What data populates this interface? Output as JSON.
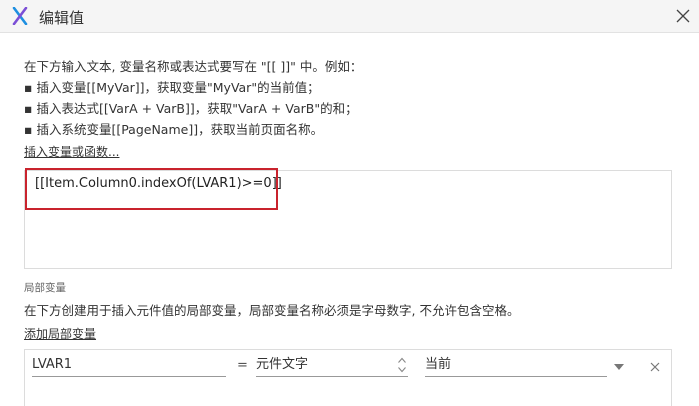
{
  "window": {
    "title": "编辑值",
    "logo_icon": "axure-x-logo-icon",
    "close_icon": "close-icon"
  },
  "help": {
    "intro": "在下方输入文本, 变量名称或表达式要写在 \"[[ ]]\" 中。例如：",
    "examples": [
      "▪ 插入变量[[MyVar]]，获取变量\"MyVar\"的当前值；",
      "▪ 插入表达式[[VarA + VarB]]，获取\"VarA + VarB\"的和；",
      "▪ 插入系统变量[[PageName]]，获取当前页面名称。"
    ]
  },
  "insert_link": "插入变量或函数...",
  "editor": {
    "value": "[[Item.Column0.indexOf(LVAR1)>=0]]"
  },
  "local_vars": {
    "section_title": "局部变量",
    "description": "在下方创建用于插入元件值的局部变量，局部变量名称必须是字母数字, 不允许包含空格。",
    "add_link": "添加局部变量",
    "rows": [
      {
        "name": "LVAR1",
        "equals": "=",
        "type": "元件文字",
        "target": "当前"
      }
    ]
  },
  "colors": {
    "highlight_border": "#c9232d",
    "logo_blue": "#1e8fe1",
    "logo_purple": "#7b4fd6"
  }
}
